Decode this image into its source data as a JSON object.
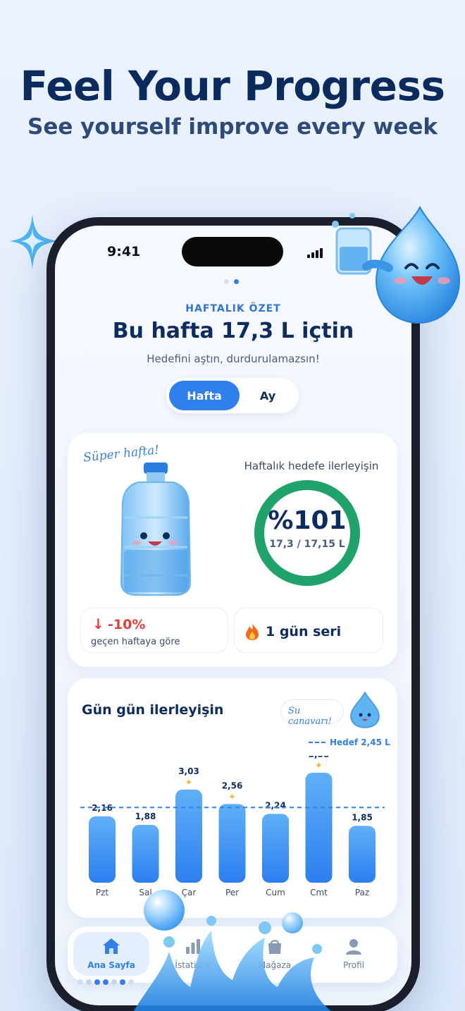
{
  "promo": {
    "headline": "Feel Your Progress",
    "subheadline": "See yourself improve every week"
  },
  "status_bar": {
    "time": "9:41"
  },
  "summary": {
    "eyebrow": "HAFTALIK ÖZET",
    "title": "Bu hafta 17,3 L içtin",
    "description": "Hedefini aştın, durdurulamazsın!",
    "segments": [
      {
        "label": "Hafta",
        "active": true
      },
      {
        "label": "Ay",
        "active": false
      }
    ]
  },
  "weekly_card": {
    "script_label": "Süper hafta!",
    "progress_label": "Haftalık hedefe ilerleyişin",
    "progress_percent_text": "%101",
    "progress_fraction": 1.01,
    "progress_detail": "17,3 / 17,15 L",
    "change_arrow": "↓",
    "change_value": "-10%",
    "change_caption": "geçen haftaya göre",
    "streak_label": "1 gün seri"
  },
  "daily_card": {
    "title": "Gün gün ilerleyişin",
    "mascot_label": "Su canavarı!",
    "goal_label": "Hedef 2,45 L"
  },
  "chart_data": {
    "type": "bar",
    "categories": [
      "Pzt",
      "Sal",
      "Çar",
      "Per",
      "Cum",
      "Cmt",
      "Paz"
    ],
    "values": [
      2.16,
      1.88,
      3.03,
      2.56,
      2.24,
      3.58,
      1.85
    ],
    "value_labels": [
      "2,16",
      "1,88",
      "3,03",
      "2,56",
      "2,24",
      "3,58",
      "1,85"
    ],
    "goal": 2.45,
    "ylim": [
      0,
      3.9
    ],
    "starred": [
      false,
      false,
      true,
      true,
      false,
      true,
      false
    ],
    "colors": {
      "bar_top": "#5fb0f7",
      "bar_bottom": "#2c7ff0",
      "goal_line": "#2f80ed"
    }
  },
  "tabbar": {
    "items": [
      {
        "label": "Ana Sayfa",
        "icon": "home-icon",
        "active": true
      },
      {
        "label": "İstatistik",
        "icon": "chart-icon",
        "active": false
      },
      {
        "label": "Mağaza",
        "icon": "bag-icon",
        "active": false
      },
      {
        "label": "Profil",
        "icon": "profile-icon",
        "active": false
      }
    ]
  },
  "colors": {
    "accent": "#2f80ed",
    "ring": "#1fa36a",
    "negative": "#e23d3d",
    "title": "#0c2b5e"
  }
}
